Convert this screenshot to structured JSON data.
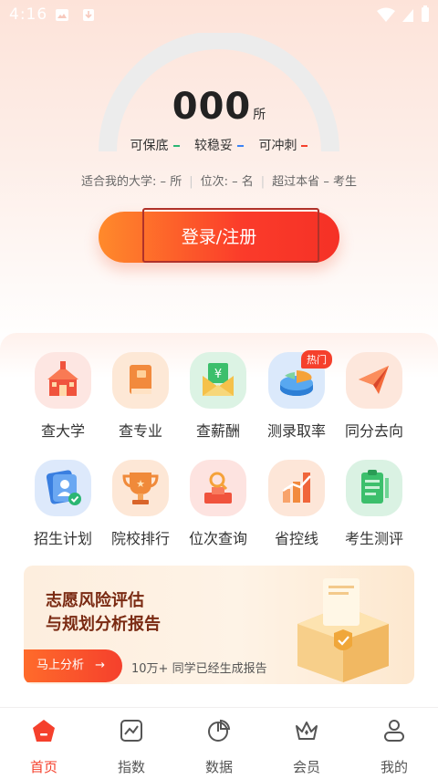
{
  "status_bar": {
    "time": "4:16"
  },
  "gauge": {
    "value": "000",
    "unit": "所"
  },
  "tiers": [
    {
      "label": "可保底",
      "dash": "–",
      "color": "#2bb673"
    },
    {
      "label": "较稳妥",
      "dash": "–",
      "color": "#3b82f6"
    },
    {
      "label": "可冲刺",
      "dash": "–",
      "color": "#f5402c"
    }
  ],
  "info": {
    "suitable_label": "适合我的大学:",
    "suitable_value": "–",
    "suitable_unit": "所",
    "rank_label": "位次:",
    "rank_value": "–",
    "rank_unit": "名",
    "beyond_label": "超过本省",
    "beyond_value": "–",
    "beyond_unit": "考生"
  },
  "login_button": "登录/注册",
  "grid": [
    {
      "label": "查大学",
      "icon": "university-icon"
    },
    {
      "label": "查专业",
      "icon": "major-book-icon"
    },
    {
      "label": "查薪酬",
      "icon": "salary-envelope-icon"
    },
    {
      "label": "测录取率",
      "icon": "admission-rate-pie-icon",
      "badge": "热门"
    },
    {
      "label": "同分去向",
      "icon": "paper-plane-icon"
    },
    {
      "label": "招生计划",
      "icon": "enrollment-plan-icon"
    },
    {
      "label": "院校排行",
      "icon": "trophy-icon"
    },
    {
      "label": "位次查询",
      "icon": "rank-search-icon"
    },
    {
      "label": "省控线",
      "icon": "province-line-chart-icon"
    },
    {
      "label": "考生测评",
      "icon": "assessment-clipboard-icon"
    }
  ],
  "banner": {
    "title_line1": "志愿风险评估",
    "title_line2": "与规划分析报告",
    "button": "马上分析",
    "note": "10万+ 同学已经生成报告"
  },
  "tabs": [
    {
      "label": "首页",
      "icon": "home-icon",
      "active": true
    },
    {
      "label": "指数",
      "icon": "index-chart-icon",
      "active": false
    },
    {
      "label": "数据",
      "icon": "data-pie-icon",
      "active": false
    },
    {
      "label": "会员",
      "icon": "member-crown-icon",
      "active": false
    },
    {
      "label": "我的",
      "icon": "profile-icon",
      "active": false
    }
  ],
  "colors": {
    "accent": "#f5402c",
    "gauge_track": "#ededed"
  }
}
